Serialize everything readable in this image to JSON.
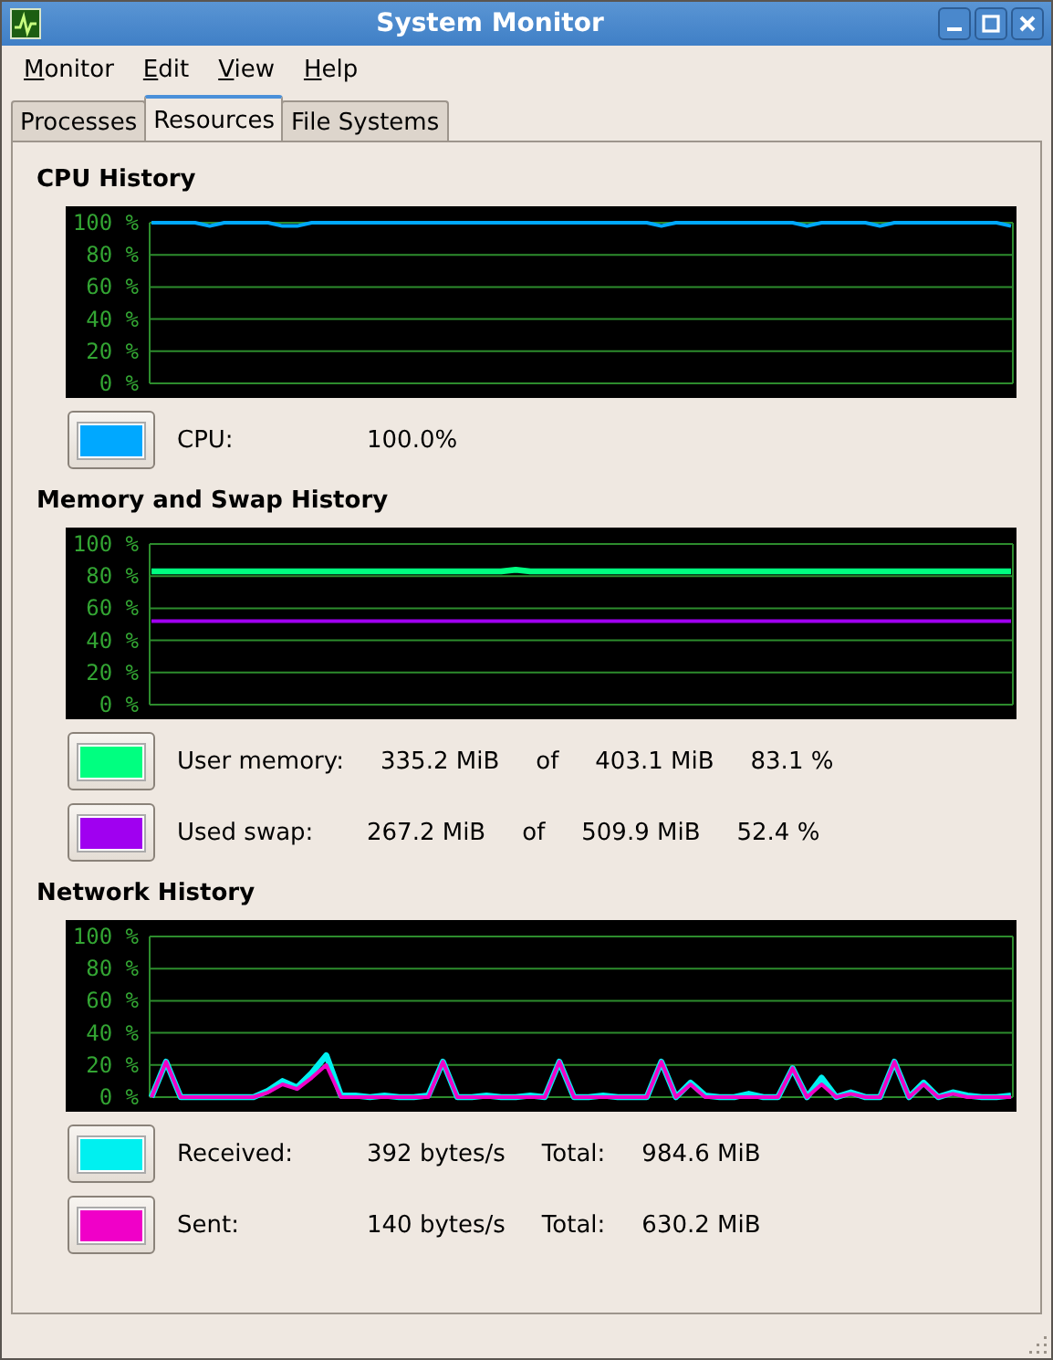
{
  "window": {
    "title": "System Monitor"
  },
  "menu": [
    "Monitor",
    "Edit",
    "View",
    "Help"
  ],
  "tabs": [
    {
      "label": "Processes",
      "selected": false
    },
    {
      "label": "Resources",
      "selected": true
    },
    {
      "label": "File Systems",
      "selected": false
    }
  ],
  "sections": [
    {
      "chart_data": {
        "type": "line",
        "grid": true,
        "title": "CPU History",
        "ylim": [
          0,
          100
        ],
        "yticks": [
          {
            "value": 0,
            "label": "0 %"
          },
          {
            "value": 20,
            "label": "20 %"
          },
          {
            "value": 40,
            "label": "40 %"
          },
          {
            "value": 60,
            "label": "60 %"
          },
          {
            "value": 80,
            "label": "80 %"
          },
          {
            "value": 100,
            "label": "100 %"
          }
        ],
        "series": [
          {
            "color": "#00a8ff",
            "values": [
              100,
              100,
              100,
              100,
              98,
              100,
              100,
              100,
              100,
              98,
              98,
              100,
              100,
              100,
              100,
              100,
              100,
              100,
              100,
              100,
              100,
              100,
              100,
              100,
              100,
              100,
              100,
              100,
              100,
              100,
              100,
              100,
              100,
              100,
              100,
              98,
              100,
              100,
              100,
              100,
              100,
              100,
              100,
              100,
              100,
              98,
              100,
              100,
              100,
              100,
              98,
              100,
              100,
              100,
              100,
              100,
              100,
              100,
              100,
              98
            ]
          }
        ]
      },
      "legend": [
        {
          "label": "CPU:",
          "fields": [
            "100.0%"
          ]
        }
      ]
    },
    {
      "chart_data": {
        "type": "line",
        "grid": true,
        "title": "Memory and Swap History",
        "ylim": [
          0,
          100
        ],
        "yticks": [
          {
            "value": 0,
            "label": "0 %"
          },
          {
            "value": 20,
            "label": "20 %"
          },
          {
            "value": 40,
            "label": "40 %"
          },
          {
            "value": 60,
            "label": "60 %"
          },
          {
            "value": 80,
            "label": "80 %"
          },
          {
            "value": 100,
            "label": "100 %"
          }
        ],
        "series": [
          {
            "color": "#00ff80",
            "values": [
              83,
              83,
              83,
              83,
              83,
              83,
              83,
              83,
              83,
              83,
              83,
              83,
              83,
              83,
              83,
              83,
              83,
              83,
              83,
              83,
              83,
              83,
              83,
              83,
              83,
              84,
              83,
              83,
              83,
              83,
              83,
              83,
              83,
              83,
              83,
              83,
              83,
              83,
              83,
              83,
              83,
              83,
              83,
              83,
              83,
              83,
              83,
              83,
              83,
              83,
              83,
              83,
              83,
              83,
              83,
              83,
              83,
              83,
              83,
              83
            ]
          },
          {
            "color": "#a000f0",
            "values": [
              52,
              52,
              52,
              52,
              52,
              52,
              52,
              52,
              52,
              52,
              52,
              52,
              52,
              52,
              52,
              52,
              52,
              52,
              52,
              52,
              52,
              52,
              52,
              52,
              52,
              52,
              52,
              52,
              52,
              52,
              52,
              52,
              52,
              52,
              52,
              52,
              52,
              52,
              52,
              52,
              52,
              52,
              52,
              52,
              52,
              52,
              52,
              52,
              52,
              52,
              52,
              52,
              52,
              52,
              52,
              52,
              52,
              52,
              52,
              52
            ]
          }
        ]
      },
      "legend": [
        {
          "label": "User memory:",
          "fields": [
            "335.2 MiB",
            "of",
            "403.1 MiB",
            "83.1 %"
          ]
        },
        {
          "label": "Used swap:",
          "fields": [
            "267.2 MiB",
            "of",
            "509.9 MiB",
            "52.4 %"
          ]
        }
      ]
    },
    {
      "chart_data": {
        "type": "line",
        "grid": true,
        "title": "Network History",
        "ylim": [
          0,
          100
        ],
        "yticks": [
          {
            "value": 0,
            "label": "0 %"
          },
          {
            "value": 20,
            "label": "20 %"
          },
          {
            "value": 40,
            "label": "40 %"
          },
          {
            "value": 60,
            "label": "60 %"
          },
          {
            "value": 80,
            "label": "80 %"
          },
          {
            "value": 100,
            "label": "100 %"
          }
        ],
        "series": [
          {
            "color": "#00f0f0",
            "values": [
              0,
              22,
              0,
              0,
              0,
              0,
              0,
              0,
              4,
              10,
              6,
              15,
              26,
              1,
              1,
              0,
              1,
              0,
              0,
              1,
              22,
              0,
              0,
              1,
              0,
              0,
              1,
              0,
              22,
              0,
              0,
              1,
              0,
              0,
              0,
              22,
              0,
              9,
              1,
              0,
              0,
              2,
              0,
              0,
              18,
              0,
              12,
              0,
              3,
              0,
              0,
              22,
              0,
              9,
              0,
              3,
              1,
              0,
              0,
              1
            ]
          },
          {
            "color": "#f000c8",
            "values": [
              0,
              22,
              0,
              0,
              0,
              0,
              0,
              0,
              3,
              8,
              5,
              12,
              20,
              0,
              0,
              0,
              0,
              0,
              0,
              0,
              22,
              0,
              0,
              0,
              0,
              0,
              0,
              0,
              22,
              0,
              0,
              0,
              0,
              0,
              0,
              22,
              0,
              8,
              0,
              0,
              0,
              0,
              0,
              0,
              18,
              0,
              8,
              0,
              2,
              0,
              0,
              22,
              0,
              8,
              0,
              2,
              0,
              0,
              0,
              0
            ]
          }
        ]
      },
      "legend": [
        {
          "label": "Received:",
          "fields": [
            "392 bytes/s",
            "Total:",
            "984.6 MiB"
          ]
        },
        {
          "label": "Sent:",
          "fields": [
            "140 bytes/s",
            "Total:",
            "630.2 MiB"
          ]
        }
      ]
    }
  ]
}
